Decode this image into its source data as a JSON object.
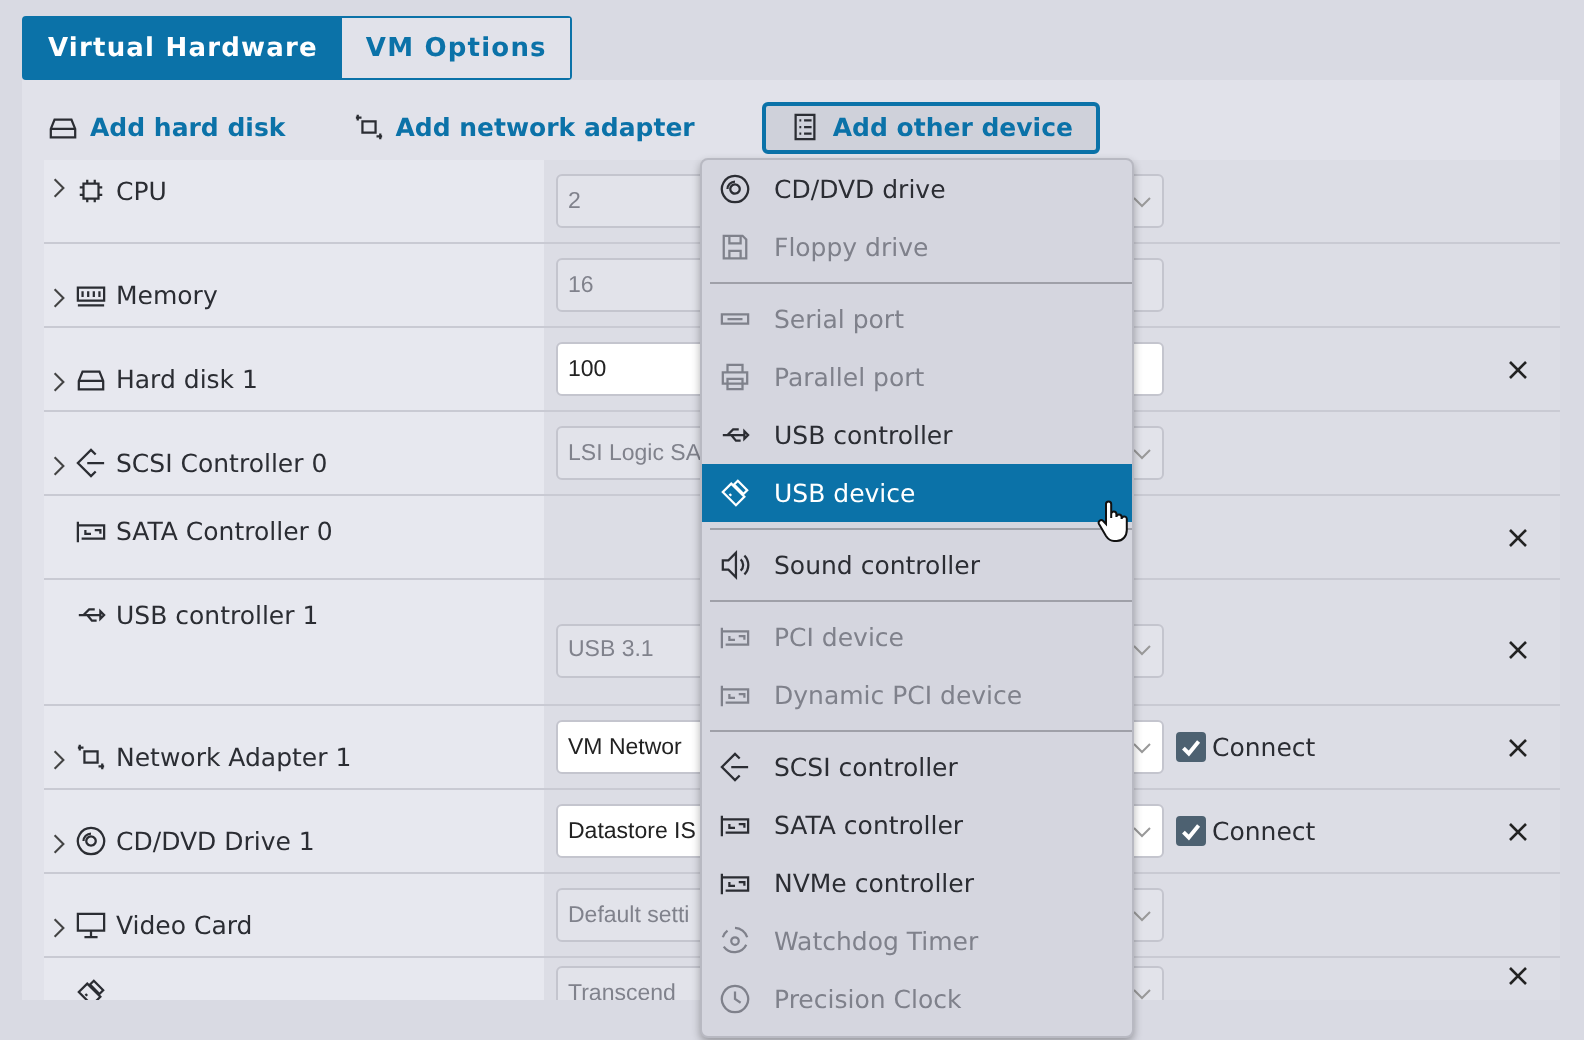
{
  "tabs": [
    {
      "label": "Virtual Hardware",
      "selected": true
    },
    {
      "label": "VM Options",
      "selected": false
    }
  ],
  "toolbar": [
    {
      "label": "Add hard disk",
      "kind": "disk",
      "active": false
    },
    {
      "label": "Add network adapter",
      "kind": "network",
      "active": false
    },
    {
      "label": "Add other device",
      "kind": "devicelist",
      "active": true
    }
  ],
  "rows": [
    {
      "label": "CPU",
      "kind": "cpu",
      "expandable": true,
      "control": {
        "kind": "select",
        "value": "2",
        "disabled": true
      },
      "removable": false
    },
    {
      "label": "Memory",
      "kind": "memory",
      "expandable": true,
      "control": {
        "kind": "input",
        "value": "16",
        "disabled": true
      },
      "removable": false
    },
    {
      "label": "Hard disk 1",
      "kind": "disk",
      "expandable": true,
      "control": {
        "kind": "input",
        "value": "100",
        "disabled": false
      },
      "removable": true
    },
    {
      "label": "SCSI Controller 0",
      "kind": "scsi",
      "expandable": true,
      "control": {
        "kind": "select",
        "value": "LSI Logic SA",
        "disabled": true
      },
      "removable": false
    },
    {
      "label": "SATA Controller 0",
      "kind": "sata",
      "expandable": false,
      "removable": true
    },
    {
      "label": "USB controller 1",
      "kind": "usb",
      "expandable": false,
      "control": {
        "kind": "select",
        "value": "USB 3.1",
        "disabled": true
      },
      "removable": true
    },
    {
      "label": "Network Adapter 1",
      "kind": "network",
      "expandable": true,
      "control": {
        "kind": "select",
        "value": "VM Networ",
        "disabled": false
      },
      "connect": {
        "label": "Connect",
        "checked": true
      },
      "removable": true
    },
    {
      "label": "CD/DVD Drive 1",
      "kind": "cdrom",
      "expandable": true,
      "control": {
        "kind": "select",
        "value": "Datastore IS",
        "disabled": false
      },
      "connect": {
        "label": "Connect",
        "checked": true
      },
      "removable": true
    },
    {
      "label": "Video Card",
      "kind": "monitor",
      "expandable": true,
      "control": {
        "kind": "select",
        "value": "Default setti",
        "disabled": true
      },
      "removable": false
    },
    {
      "kind": "usbstick",
      "expandable": false,
      "control": {
        "kind": "select",
        "value": "Transcend",
        "disabled": true
      },
      "removable": true
    }
  ],
  "menu": {
    "groups": [
      [
        {
          "label": "CD/DVD drive",
          "kind": "cdrom",
          "disabled": false,
          "selected": false
        },
        {
          "label": "Floppy drive",
          "kind": "floppy",
          "disabled": true,
          "selected": false
        }
      ],
      [
        {
          "label": "Serial port",
          "kind": "serial",
          "disabled": true,
          "selected": false
        },
        {
          "label": "Parallel port",
          "kind": "printer",
          "disabled": true,
          "selected": false
        },
        {
          "label": "USB controller",
          "kind": "usb",
          "disabled": false,
          "selected": false
        },
        {
          "label": "USB device",
          "kind": "usbstick",
          "disabled": false,
          "selected": true
        }
      ],
      [
        {
          "label": "Sound controller",
          "kind": "sound",
          "disabled": false,
          "selected": false
        }
      ],
      [
        {
          "label": "PCI device",
          "kind": "sata",
          "disabled": true,
          "selected": false
        },
        {
          "label": "Dynamic PCI device",
          "kind": "sata",
          "disabled": true,
          "selected": false
        }
      ],
      [
        {
          "label": "SCSI controller",
          "kind": "scsi",
          "disabled": false,
          "selected": false
        },
        {
          "label": "SATA controller",
          "kind": "sata",
          "disabled": false,
          "selected": false
        },
        {
          "label": "NVMe controller",
          "kind": "sata",
          "disabled": false,
          "selected": false
        },
        {
          "label": "Watchdog Timer",
          "kind": "watchdog",
          "disabled": true,
          "selected": false
        },
        {
          "label": "Precision Clock",
          "kind": "clock",
          "disabled": true,
          "selected": false
        }
      ]
    ]
  }
}
